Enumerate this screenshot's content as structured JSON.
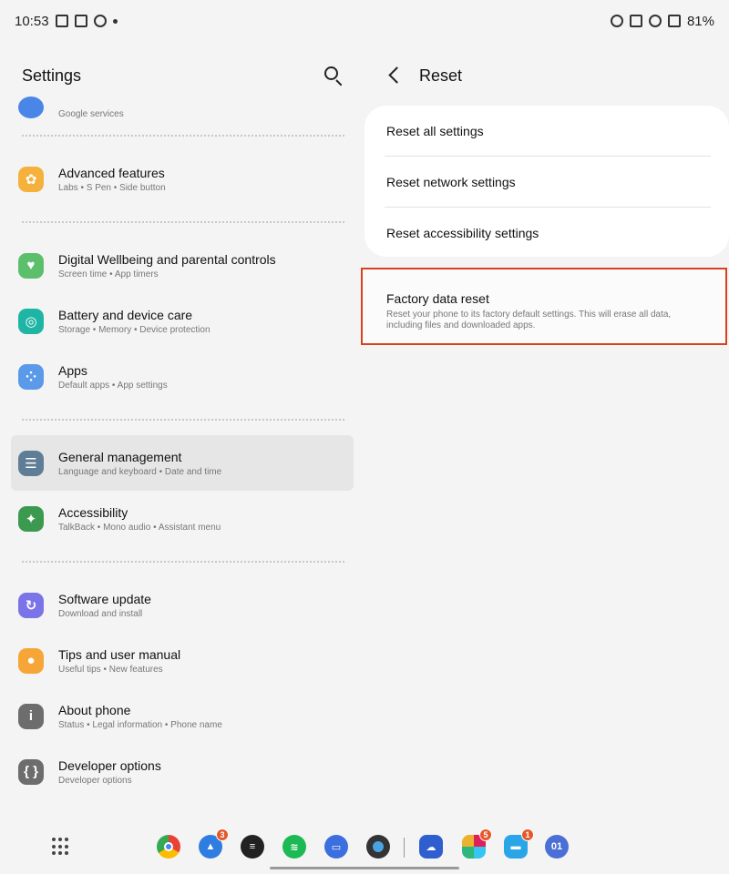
{
  "status_bar": {
    "time": "10:53",
    "battery": "81%",
    "left_icons": [
      "gallery-icon",
      "calendar-icon",
      "record-icon",
      "dot-icon"
    ],
    "right_icons": [
      "alarm-icon",
      "mute-icon",
      "wifi-icon",
      "signal-icon"
    ]
  },
  "left_panel": {
    "title": "Settings",
    "partial_item_sub": "Google services",
    "items": [
      {
        "title": "Advanced features",
        "sub": "Labs  •  S Pen  •  Side button",
        "icon": "advanced-features-icon",
        "color": "#f4b23c"
      },
      {
        "title": "Digital Wellbeing and parental controls",
        "sub": "Screen time  •  App timers",
        "icon": "wellbeing-icon",
        "color": "#5cbf6b"
      },
      {
        "title": "Battery and device care",
        "sub": "Storage  •  Memory  •  Device protection",
        "icon": "battery-care-icon",
        "color": "#1fb5a4"
      },
      {
        "title": "Apps",
        "sub": "Default apps  •  App settings",
        "icon": "apps-icon",
        "color": "#5b9ae8"
      },
      {
        "title": "General management",
        "sub": "Language and keyboard  •  Date and time",
        "icon": "general-management-icon",
        "color": "#5f7d96"
      },
      {
        "title": "Accessibility",
        "sub": "TalkBack  •  Mono audio  •  Assistant menu",
        "icon": "accessibility-icon",
        "color": "#3b9a4f"
      },
      {
        "title": "Software update",
        "sub": "Download and install",
        "icon": "software-update-icon",
        "color": "#7b73e8"
      },
      {
        "title": "Tips and user manual",
        "sub": "Useful tips  •  New features",
        "icon": "tips-icon",
        "color": "#f6a637"
      },
      {
        "title": "About phone",
        "sub": "Status  •  Legal information  •  Phone name",
        "icon": "about-phone-icon",
        "color": "#6d6d6d"
      },
      {
        "title": "Developer options",
        "sub": "Developer options",
        "icon": "developer-options-icon",
        "color": "#6d6d6d"
      }
    ]
  },
  "right_panel": {
    "title": "Reset",
    "options": [
      "Reset all settings",
      "Reset network settings",
      "Reset accessibility settings"
    ],
    "factory": {
      "title": "Factory data reset",
      "description": "Reset your phone to its factory default settings. This will erase all data, including files and downloaded apps."
    },
    "highlight_color": "#d9411e"
  },
  "dock": {
    "badges": {
      "app2": "3",
      "slack": "5",
      "app10": "1"
    },
    "app10_label": "01"
  }
}
